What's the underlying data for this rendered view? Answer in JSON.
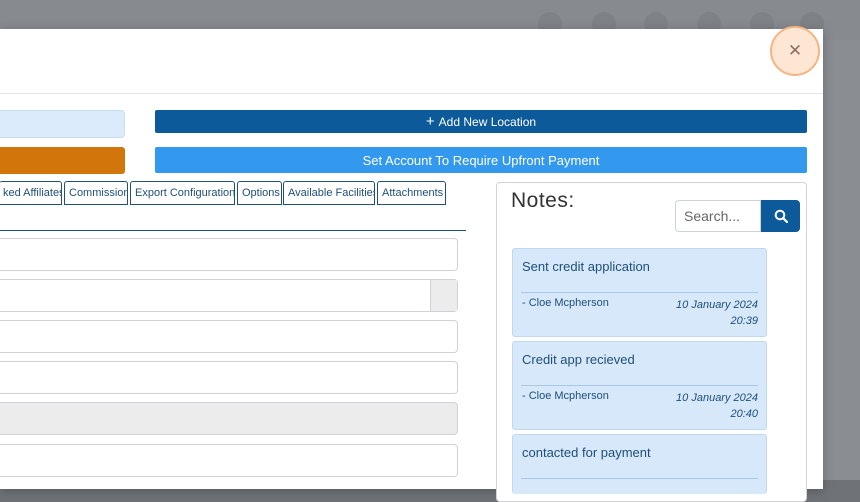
{
  "modal": {
    "close_glyph": "✕",
    "buttons": {
      "add_location": {
        "icon": "plus-icon",
        "glyph": "+",
        "label": "Add New Location"
      },
      "upfront_payment": {
        "label": "Set Account To Require Upfront Payment"
      }
    },
    "tabs": [
      {
        "label": "ked Affiliates"
      },
      {
        "label": "Commission"
      },
      {
        "label": "Export Configuration"
      },
      {
        "label": "Options"
      },
      {
        "label": "Available Facilities"
      },
      {
        "label": "Attachments"
      }
    ],
    "notes": {
      "title": "Notes:",
      "search_placeholder": "Search...",
      "search_icon": "search-icon",
      "items": [
        {
          "text": "Sent credit application",
          "author": "- Cloe Mcpherson",
          "date": "10 January 2024",
          "time": "20:39"
        },
        {
          "text": "Credit app recieved",
          "author": "- Cloe Mcpherson",
          "date": "10 January 2024",
          "time": "20:40"
        },
        {
          "text": "contacted for payment",
          "author": "",
          "date": "",
          "time": ""
        }
      ]
    }
  },
  "colors": {
    "primary_dark": "#0d5a9a",
    "primary_light": "#3399ee",
    "orange": "#d2760c",
    "note_bg": "#d6e8fa"
  }
}
